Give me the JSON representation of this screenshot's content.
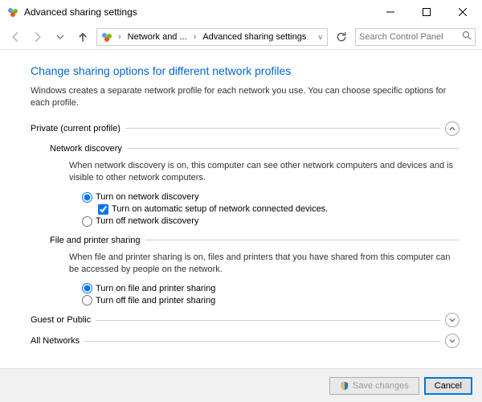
{
  "window": {
    "title": "Advanced sharing settings"
  },
  "breadcrumb": {
    "item1": "Network and ...",
    "item2": "Advanced sharing settings"
  },
  "search": {
    "placeholder": "Search Control Panel"
  },
  "heading": "Change sharing options for different network profiles",
  "intro": "Windows creates a separate network profile for each network you use. You can choose specific options for each profile.",
  "sections": {
    "private": {
      "label": "Private (current profile)",
      "net_discovery": {
        "label": "Network discovery",
        "desc": "When network discovery is on, this computer can see other network computers and devices and is visible to other network computers.",
        "on": "Turn on network discovery",
        "auto": "Turn on automatic setup of network connected devices.",
        "off": "Turn off network discovery"
      },
      "file_share": {
        "label": "File and printer sharing",
        "desc": "When file and printer sharing is on, files and printers that you have shared from this computer can be accessed by people on the network.",
        "on": "Turn on file and printer sharing",
        "off": "Turn off file and printer sharing"
      }
    },
    "guest": {
      "label": "Guest or Public"
    },
    "all": {
      "label": "All Networks"
    }
  },
  "footer": {
    "save": "Save changes",
    "cancel": "Cancel"
  }
}
